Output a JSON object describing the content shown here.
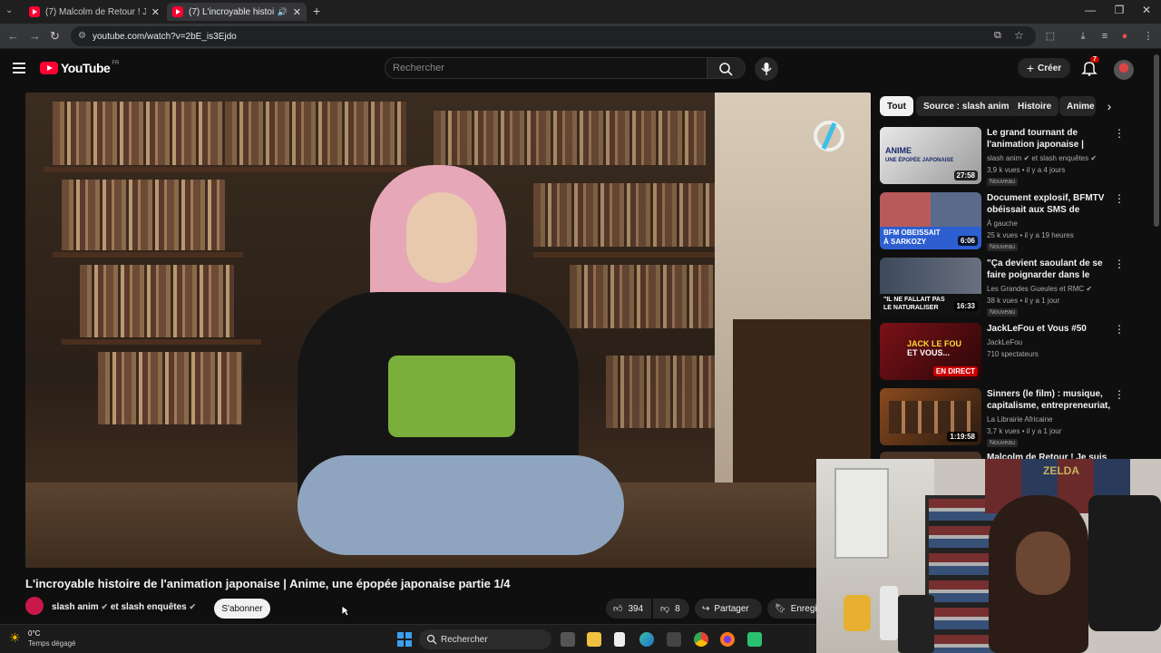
{
  "browser": {
    "tabs": [
      {
        "title": "(7) Malcolm de Retour ! Je suis",
        "active": false
      },
      {
        "title": "(7) L'incroyable histoire de l",
        "active": true
      }
    ],
    "url": "youtube.com/watch?v=2bE_is3Ejdo"
  },
  "youtube": {
    "logo_text": "YouTube",
    "region": "FR",
    "search_placeholder": "Rechercher",
    "create_label": "Créer",
    "notif_count": "7"
  },
  "video": {
    "title": "L'incroyable histoire de l'animation japonaise | Anime, une épopée japonaise partie 1/4",
    "channel_text": "slash anim",
    "channel_and": "et slash enquêtes",
    "subscribe_label": "S'abonner",
    "likes": "394",
    "dislikes": "8",
    "share_label": "Partager",
    "save_label": "Enregi"
  },
  "chips": [
    "Tout",
    "Source : slash anim",
    "Histoire",
    "Anime"
  ],
  "recommendations": [
    {
      "title": "Le grand tournant de l'animation japonaise | Anime, ...",
      "channel": "slash anim",
      "channel2": "et slash enquêtes",
      "meta": "3,9 k vues • il y a 4 jours",
      "badge": "Nouveau",
      "duration": "27:58",
      "thumb_text": "ANIME\nUNE ÉPOPÉE JAPONAISE",
      "thumb_color": "#d9d9d9"
    },
    {
      "title": "Document explosif, BFMTV obéissait aux SMS de Sarkozy",
      "channel": "À gauche",
      "channel2": "",
      "meta": "25 k vues • il y a 19 heures",
      "badge": "Nouveau",
      "duration": "6:06",
      "thumb_text": "BFM OBEISSAIT À SARKOZY",
      "thumb_color": "#3a5fb0"
    },
    {
      "title": "\"Ça devient saoulant de se faire poignarder dans le métro\"",
      "channel": "Les Grandes Gueules et RMC",
      "channel2": "",
      "meta": "38 k vues • il y a 1 jour",
      "badge": "Nouveau",
      "duration": "16:33",
      "thumb_text": "\"IL NE FALLAIT PAS LE NATURALISER\"",
      "thumb_color": "#2d3a4a"
    },
    {
      "title": "JackLeFou et Vous #50",
      "channel": "JackLeFou",
      "channel2": "",
      "meta": "710 spectateurs",
      "badge": "",
      "duration": "",
      "live": "EN DIRECT",
      "thumb_text": "JACK LE FOU ET VOUS...",
      "thumb_color": "#5a0d12"
    },
    {
      "title": "Sinners (le film) : musique, capitalisme, entrepreneuriat, ...",
      "channel": "La Librairie Africaine",
      "channel2": "",
      "meta": "3,7 k vues • il y a 1 jour",
      "badge": "Nouveau",
      "duration": "1:19:58",
      "thumb_text": "SINNERS LE FILM",
      "thumb_color": "#6a3b1c"
    },
    {
      "title": "Malcolm de Retour ! Je suis",
      "channel": "",
      "channel2": "",
      "meta": "",
      "badge": "",
      "duration": "",
      "thumb_text": "",
      "thumb_color": "#3a2a20"
    }
  ],
  "taskbar": {
    "temp": "0°C",
    "weather": "Temps dégagé",
    "search": "Rechercher"
  },
  "colors": {
    "accent": "#ff0033",
    "bg": "#0f0f0f",
    "chip": "#272727"
  }
}
